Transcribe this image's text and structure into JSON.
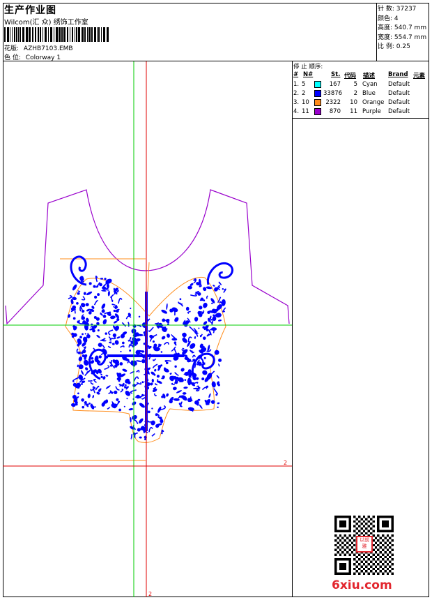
{
  "header": {
    "title": "生产作业图",
    "company": "Wilcom(汇 众) 绣饰工作室",
    "design_label": "花版:",
    "design_value": "AZHB7103.EMB",
    "colorway_label": "色 位:",
    "colorway_value": "Colorway 1"
  },
  "stats": [
    {
      "label": "针 数:",
      "value": "37237"
    },
    {
      "label": "颜色:",
      "value": "4"
    },
    {
      "label": "高度:",
      "value": "540.7 mm"
    },
    {
      "label": "宽度:",
      "value": "554.7 mm"
    },
    {
      "label": "比 例:",
      "value": "0.25"
    }
  ],
  "color_table": {
    "title": "停 止 顺序:",
    "headers": [
      "#",
      "N#",
      "St.",
      "代码",
      "描述",
      "Brand",
      "元素"
    ],
    "rows": [
      {
        "index": "1.",
        "n": "5",
        "stitches": "167",
        "code": "5",
        "desc": "Cyan",
        "brand": "Default",
        "color": "#00ffff"
      },
      {
        "index": "2.",
        "n": "2",
        "stitches": "33876",
        "code": "2",
        "desc": "Blue",
        "brand": "Default",
        "color": "#0000ff"
      },
      {
        "index": "3.",
        "n": "10",
        "stitches": "2322",
        "code": "10",
        "desc": "Orange",
        "brand": "Default",
        "color": "#ff8c1a"
      },
      {
        "index": "4.",
        "n": "11",
        "stitches": "870",
        "code": "11",
        "desc": "Purple",
        "brand": "Default",
        "color": "#9900cc"
      }
    ]
  },
  "canvas": {
    "axis_marker_right": "2",
    "axis_marker_bottom": "2",
    "outline_color": "#9900cc",
    "embroidery_color": "#0000ff",
    "border_color": "#ff8c1a",
    "guide_green": "#00cc00",
    "guide_red": "#e00000"
  },
  "watermark": {
    "text": "6xiu.com",
    "stamp_text": "以前雅"
  }
}
